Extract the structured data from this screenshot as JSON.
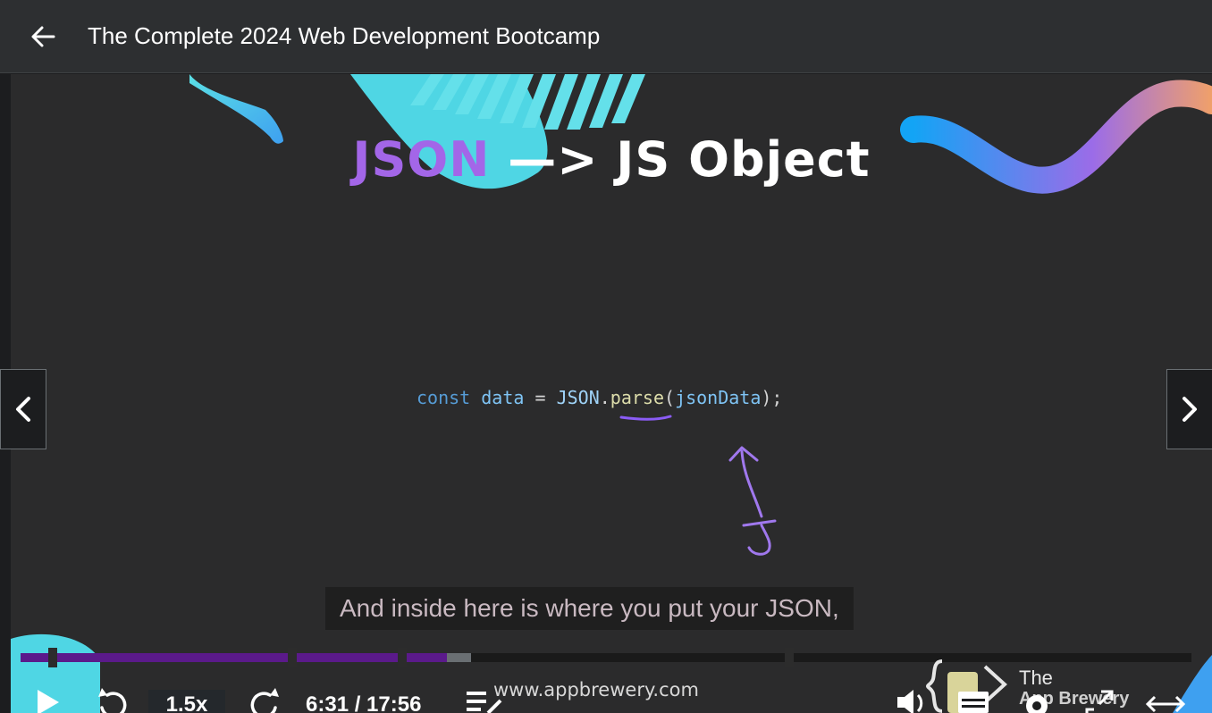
{
  "header": {
    "title": "The Complete 2024 Web Development Bootcamp",
    "back_icon": "arrow-left-icon"
  },
  "slide": {
    "title_json": "JSON",
    "title_rest": "—> JS Object",
    "code": {
      "kw": "const",
      "var": "data",
      "eq": "=",
      "cls": "JSON",
      "dot": ".",
      "fn": "parse",
      "open": "(",
      "arg": "jsonData",
      "close": ");"
    },
    "accent_purple": "#a366e8"
  },
  "caption": "And inside here is where you put your JSON,",
  "nav": {
    "prev_icon": "chevron-left-icon",
    "next_icon": "chevron-right-icon"
  },
  "player": {
    "played_fraction": 0.364,
    "buffered_fraction": 0.385,
    "chapter_marks": [
      0.024,
      0.228,
      0.322,
      0.653
    ],
    "played_color": "#5b1a8b",
    "speed": "1.5x",
    "time": "6:31 / 17:56",
    "watermark": "www.appbrewery.com",
    "brand_line1": "The",
    "brand_line2": "App Brewery"
  }
}
